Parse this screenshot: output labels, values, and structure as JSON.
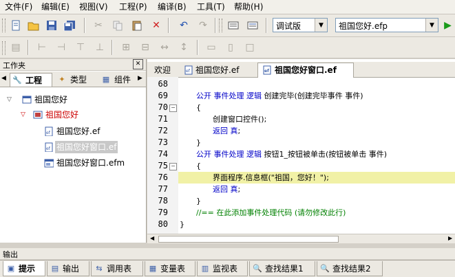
{
  "menu": {
    "file": "文件(F)",
    "edit": "编辑(E)",
    "view": "视图(V)",
    "project": "工程(P)",
    "compile": "编译(B)",
    "tools": "工具(T)",
    "help": "帮助(H)"
  },
  "toolbar": {
    "build_mode": "调试版",
    "project_file": "祖国您好.efp"
  },
  "left_panel": {
    "title": "工作夹",
    "close_glyph": "✕",
    "tabs": [
      "工程",
      "类型",
      "组件"
    ],
    "tree": [
      {
        "label": "祖国您好"
      },
      {
        "label": "祖国您好"
      },
      {
        "label": "祖国您好.ef"
      },
      {
        "label": "祖国您好窗口.ef"
      },
      {
        "label": "祖国您好窗口.efm"
      }
    ]
  },
  "editor": {
    "tabs": [
      "欢迎",
      "祖国您好.ef",
      "祖国您好窗口.ef"
    ],
    "line_numbers": [
      "68",
      "69",
      "70",
      "71",
      "72",
      "73",
      "74",
      "75",
      "76",
      "77",
      "78",
      "79",
      "80"
    ],
    "lines": [
      {
        "segments": [
          {
            "t": "",
            "c": ""
          }
        ]
      },
      {
        "segments": [
          {
            "t": "公开 事件处理 逻辑 ",
            "c": "kw"
          },
          {
            "t": "创建完毕(创建完毕事件 事件)",
            "c": ""
          }
        ]
      },
      {
        "segments": [
          {
            "t": "{",
            "c": ""
          }
        ]
      },
      {
        "segments": [
          {
            "t": "创建窗口控件();",
            "c": ""
          }
        ]
      },
      {
        "segments": [
          {
            "t": "返回 真",
            "c": "kw"
          },
          {
            "t": ";",
            "c": ""
          }
        ]
      },
      {
        "segments": [
          {
            "t": "}",
            "c": ""
          }
        ]
      },
      {
        "segments": [
          {
            "t": "公开 事件处理 逻辑 ",
            "c": "kw"
          },
          {
            "t": "按钮1_按钮被单击(按钮被单击 事件)",
            "c": ""
          }
        ]
      },
      {
        "segments": [
          {
            "t": "{",
            "c": ""
          }
        ]
      },
      {
        "segments": [
          {
            "t": "界面程序.信息框(\"祖国，您好！\");",
            "c": ""
          }
        ]
      },
      {
        "segments": [
          {
            "t": "返回 真",
            "c": "kw"
          },
          {
            "t": ";",
            "c": ""
          }
        ]
      },
      {
        "segments": [
          {
            "t": "}",
            "c": ""
          }
        ]
      },
      {
        "segments": [
          {
            "t": "//== 在此添加事件处理代码 (请勿修改此行)",
            "c": "cm"
          }
        ]
      },
      {
        "segments": [
          {
            "t": "}",
            "c": ""
          }
        ]
      }
    ]
  },
  "output_panel": {
    "title": "输出",
    "tabs": [
      "提示",
      "输出",
      "调用表",
      "变量表",
      "监视表",
      "查找结果1",
      "查找结果2"
    ]
  },
  "colors": {
    "keyword": "#0000c8",
    "comment": "#008000",
    "highlight_line": "#f1f1a6",
    "tree_active": "#cc0000"
  }
}
